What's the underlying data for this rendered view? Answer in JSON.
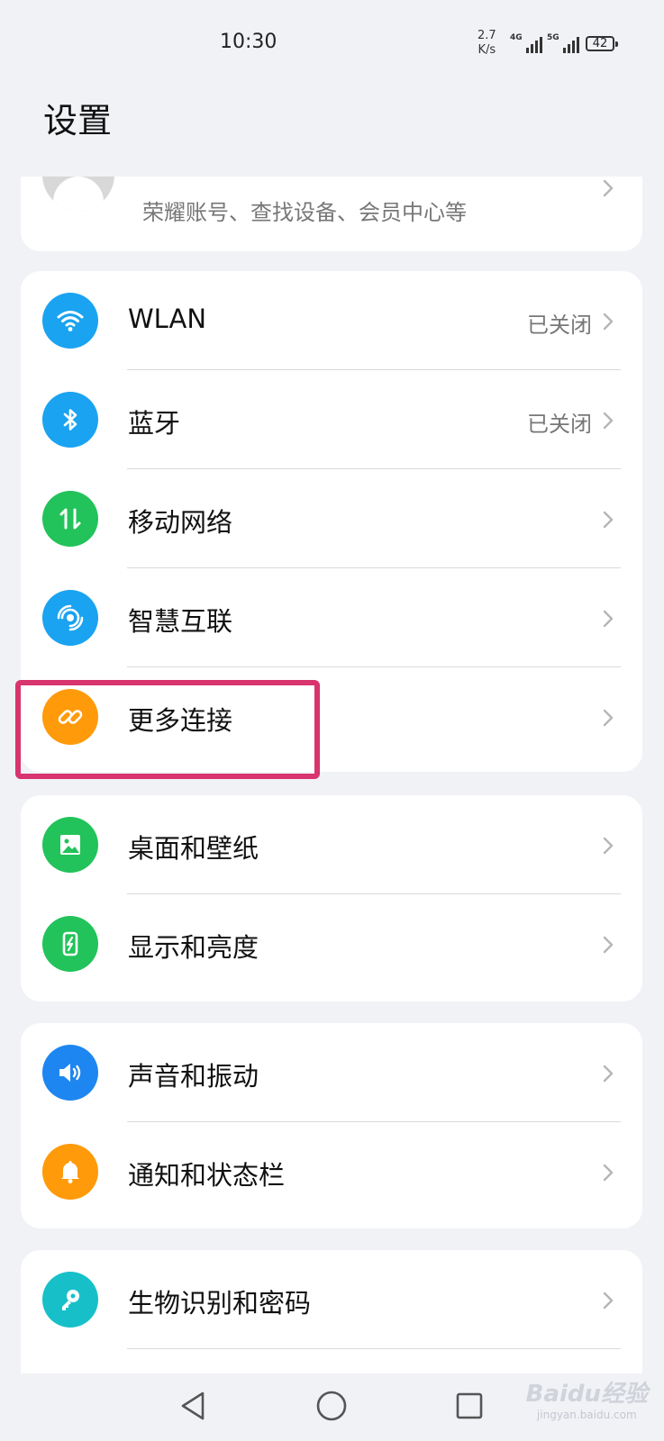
{
  "status_bar": {
    "time": "10:30",
    "net_speed_value": "2.7",
    "net_speed_unit": "K/s",
    "signal_1_tag": "4G",
    "signal_2_tag": "5G",
    "battery": "42"
  },
  "page_title": "设置",
  "account": {
    "subtitle": "荣耀账号、查找设备、会员中心等"
  },
  "connectivity": [
    {
      "label": "WLAN",
      "value": "已关闭",
      "icon": "wifi-icon",
      "color": "#1aa3f0"
    },
    {
      "label": "蓝牙",
      "value": "已关闭",
      "icon": "bluetooth-icon",
      "color": "#1aa3f0"
    },
    {
      "label": "移动网络",
      "value": "",
      "icon": "mobile-data-icon",
      "color": "#22c35a"
    },
    {
      "label": "智慧互联",
      "value": "",
      "icon": "smart-connect-icon",
      "color": "#1aa3f0"
    },
    {
      "label": "更多连接",
      "value": "",
      "icon": "link-icon",
      "color": "#ff9a0a"
    }
  ],
  "display": [
    {
      "label": "桌面和壁纸",
      "icon": "wallpaper-icon",
      "color": "#22c35a"
    },
    {
      "label": "显示和亮度",
      "icon": "brightness-icon",
      "color": "#22c35a"
    }
  ],
  "sound": [
    {
      "label": "声音和振动",
      "icon": "speaker-icon",
      "color": "#1e86f0"
    },
    {
      "label": "通知和状态栏",
      "icon": "bell-icon",
      "color": "#ff9a0a"
    }
  ],
  "security": [
    {
      "label": "生物识别和密码",
      "icon": "key-icon",
      "color": "#17c0c8"
    }
  ],
  "watermark": {
    "main": "Baidu经验",
    "sub": "jingyan.baidu.com"
  }
}
